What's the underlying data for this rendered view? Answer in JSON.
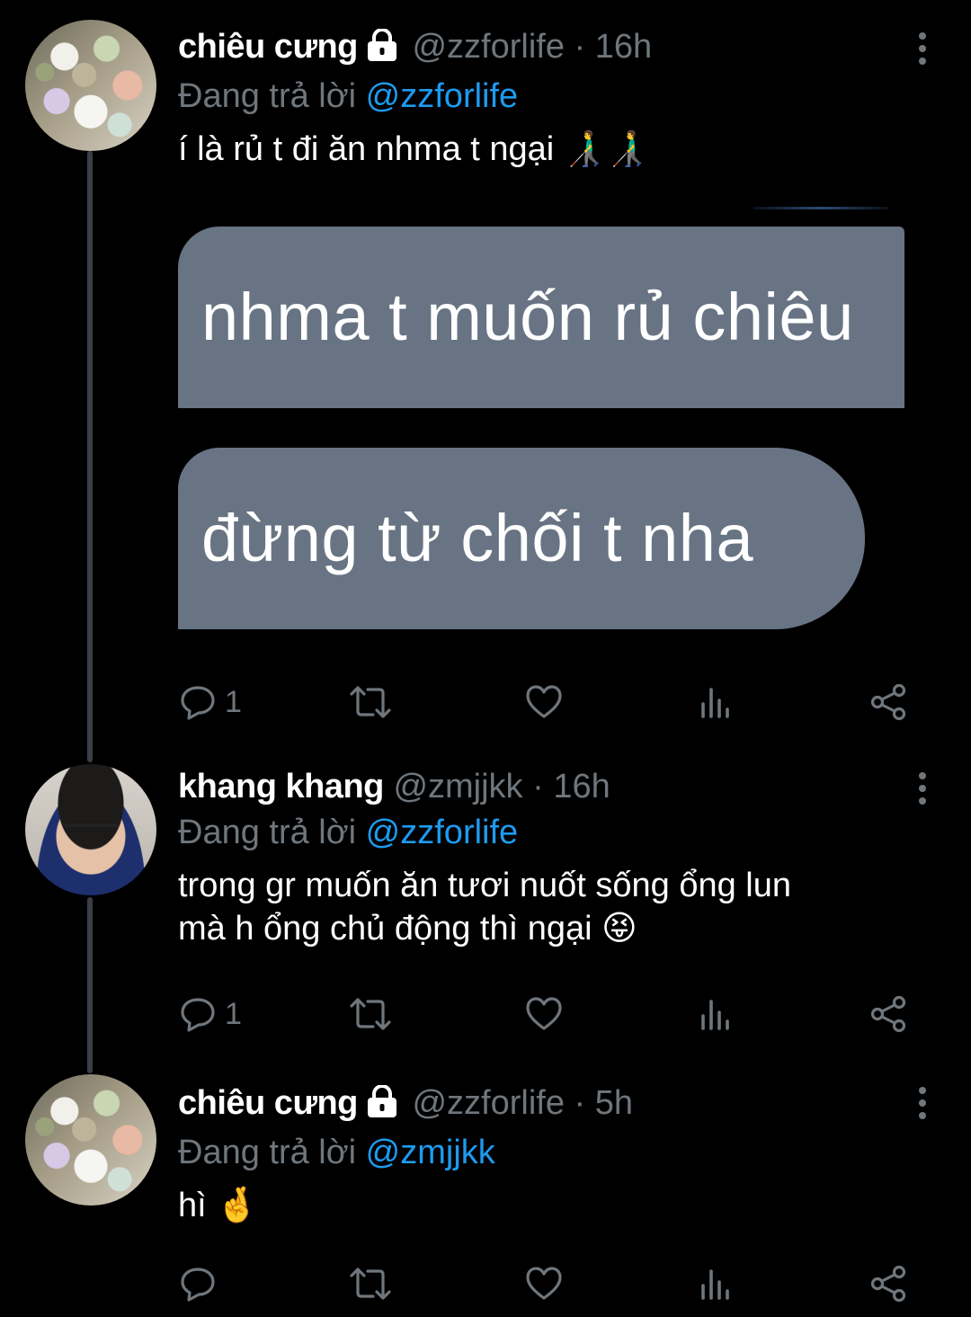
{
  "thread": [
    {
      "name": "chiêu cưng",
      "locked": true,
      "handle": "@zzforlife",
      "separator": "·",
      "time": "16h",
      "reply_prefix": "Đang trả lời",
      "reply_to": "@zzforlife",
      "text": "í là rủ t đi ăn nhma t ngại 👨‍🦯👨‍🦯",
      "media": {
        "bubble_1": "nhma t muốn rủ chiêu",
        "bubble_2": "đừng từ chối t nha"
      },
      "actions": {
        "reply_count": "1",
        "retweet_count": "",
        "like_count": ""
      }
    },
    {
      "name": "khang khang",
      "locked": false,
      "handle": "@zmjjkk",
      "separator": "·",
      "time": "16h",
      "reply_prefix": "Đang trả lời",
      "reply_to": "@zzforlife",
      "text_line_1": "trong gr muốn ăn tươi nuốt sống ổng lun",
      "text_line_2": "mà h ổng chủ động thì ngại 😝",
      "actions": {
        "reply_count": "1",
        "retweet_count": "",
        "like_count": ""
      }
    },
    {
      "name": "chiêu cưng",
      "locked": true,
      "handle": "@zzforlife",
      "separator": "·",
      "time": "5h",
      "reply_prefix": "Đang trả lời",
      "reply_to": "@zmjjkk",
      "text": "hì 🤞",
      "actions": {
        "reply_count": "",
        "retweet_count": "",
        "like_count": ""
      }
    }
  ],
  "colors": {
    "background": "#000000",
    "text": "#ffffff",
    "muted": "#6f767c",
    "mention": "#1d9bf0",
    "bubble": "#687483",
    "thread_line": "#3a3f45"
  },
  "icons": [
    "lock-icon",
    "more-vertical-icon",
    "reply-icon",
    "retweet-icon",
    "like-icon",
    "analytics-icon",
    "share-icon"
  ]
}
